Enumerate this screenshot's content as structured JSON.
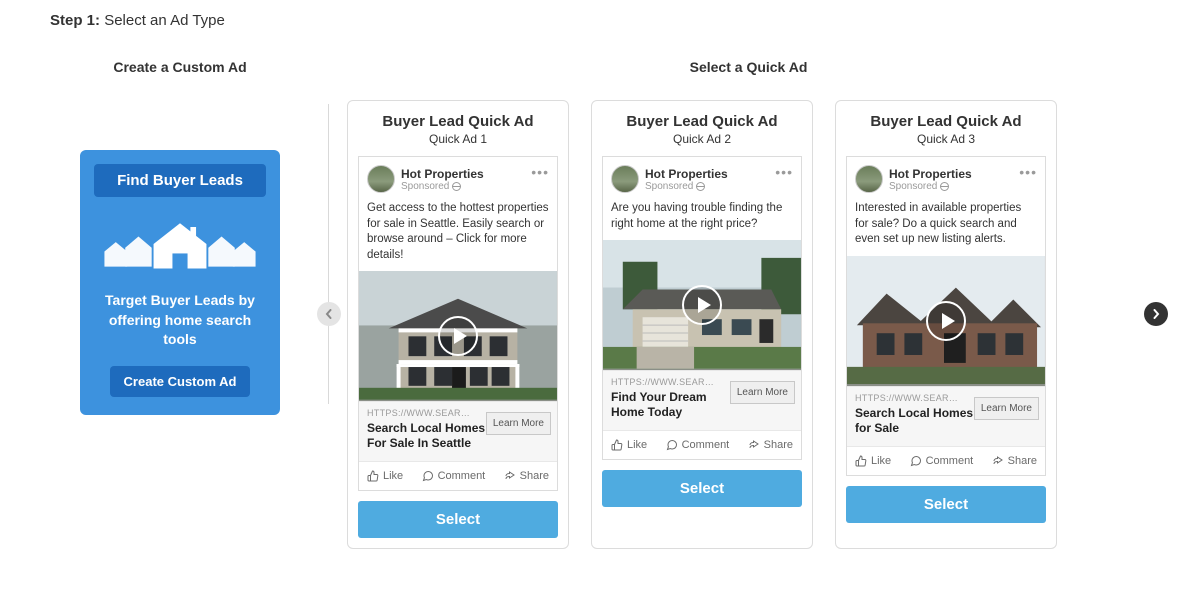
{
  "step": {
    "label": "Step 1:",
    "title": "Select an Ad Type"
  },
  "left": {
    "heading": "Create a Custom Ad",
    "card": {
      "title": "Find Buyer Leads",
      "tag": "Target Buyer Leads by offering home search tools",
      "button": "Create Custom Ad"
    }
  },
  "right": {
    "heading": "Select a Quick Ad",
    "learn_more": "Learn More",
    "actions": {
      "like": "Like",
      "comment": "Comment",
      "share": "Share"
    },
    "select_label": "Select",
    "cards": [
      {
        "title": "Buyer Lead Quick Ad",
        "sub": "Quick Ad 1",
        "page_name": "Hot Properties",
        "sponsored": "Sponsored",
        "body": "Get access to the hottest properties for sale in Seattle. Easily search or browse around – Click for more details!",
        "link_url": "HTTPS://WWW.SEAR…",
        "link_title": "Search Local Homes For Sale In Seattle"
      },
      {
        "title": "Buyer Lead Quick Ad",
        "sub": "Quick Ad 2",
        "page_name": "Hot Properties",
        "sponsored": "Sponsored",
        "body": "Are you having trouble finding the right home at the right price?",
        "link_url": "HTTPS://WWW.SEAR…",
        "link_title": "Find Your Dream Home Today"
      },
      {
        "title": "Buyer Lead Quick Ad",
        "sub": "Quick Ad 3",
        "page_name": "Hot Properties",
        "sponsored": "Sponsored",
        "body": "Interested in available properties for sale? Do a quick search and even set up new listing alerts.",
        "link_url": "HTTPS://WWW.SEAR…",
        "link_title": "Search Local Homes for Sale"
      }
    ]
  }
}
